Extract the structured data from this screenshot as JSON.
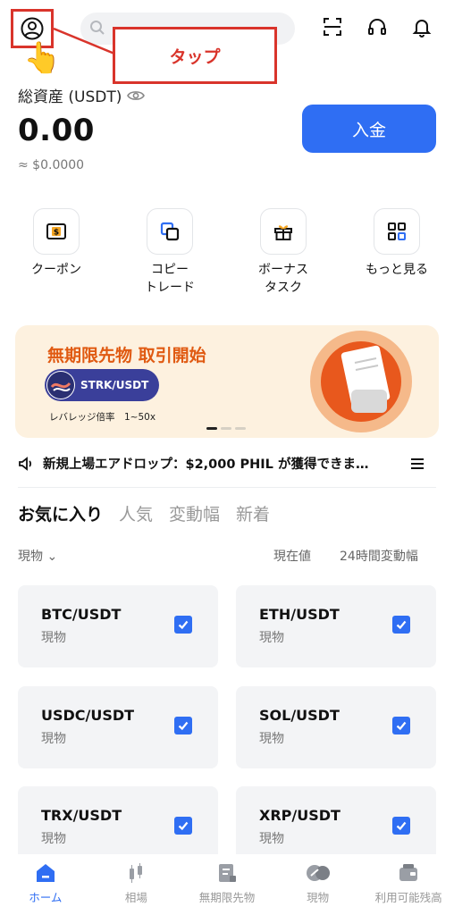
{
  "annotation": {
    "callout_label": "タップ"
  },
  "search": {
    "placeholder": ""
  },
  "balance": {
    "label": "総資産 (USDT)",
    "value": "0.00",
    "fiat": "≈ $0.0000",
    "deposit_label": "入金"
  },
  "quick_actions": [
    {
      "label": "クーポン",
      "icon": "coupon-icon"
    },
    {
      "label": "コピー\nトレード",
      "icon": "copy-trade-icon"
    },
    {
      "label": "ボーナス\nタスク",
      "icon": "gift-icon"
    },
    {
      "label": "もっと見る",
      "icon": "grid-icon"
    }
  ],
  "banner": {
    "title": "無期限先物 取引開始",
    "pair": "STRK/USDT",
    "subtitle": "レバレッジ倍率　1~50x",
    "slides": 3,
    "active_slide": 1
  },
  "announcement": {
    "text": "新規上場エアドロップ：$2,000 PHIL が獲得できま…"
  },
  "market_tabs": [
    "お気に入り",
    "人気",
    "変動幅",
    "新着"
  ],
  "active_tab": "お気に入り",
  "filters": {
    "market_type": "現物 ⌄",
    "price_header": "現在値",
    "change_header": "24時間変動幅"
  },
  "favorites": [
    {
      "pair": "BTC/USDT",
      "type": "現物",
      "checked": true
    },
    {
      "pair": "ETH/USDT",
      "type": "現物",
      "checked": true
    },
    {
      "pair": "USDC/USDT",
      "type": "現物",
      "checked": true
    },
    {
      "pair": "SOL/USDT",
      "type": "現物",
      "checked": true
    },
    {
      "pair": "TRX/USDT",
      "type": "現物",
      "checked": true
    },
    {
      "pair": "XRP/USDT",
      "type": "現物",
      "checked": true
    }
  ],
  "bottom_nav": [
    {
      "label": "ホーム",
      "icon": "home-icon",
      "active": true
    },
    {
      "label": "相場",
      "icon": "candlestick-icon",
      "active": false
    },
    {
      "label": "無期限先物",
      "icon": "futures-icon",
      "active": false
    },
    {
      "label": "現物",
      "icon": "spot-icon",
      "active": false
    },
    {
      "label": "利用可能残高",
      "icon": "wallet-icon",
      "active": false
    }
  ],
  "colors": {
    "accent": "#2f6ef3",
    "annotation_red": "#d9342b",
    "banner_bg": "#fdf1df",
    "banner_title": "#e05a12"
  }
}
